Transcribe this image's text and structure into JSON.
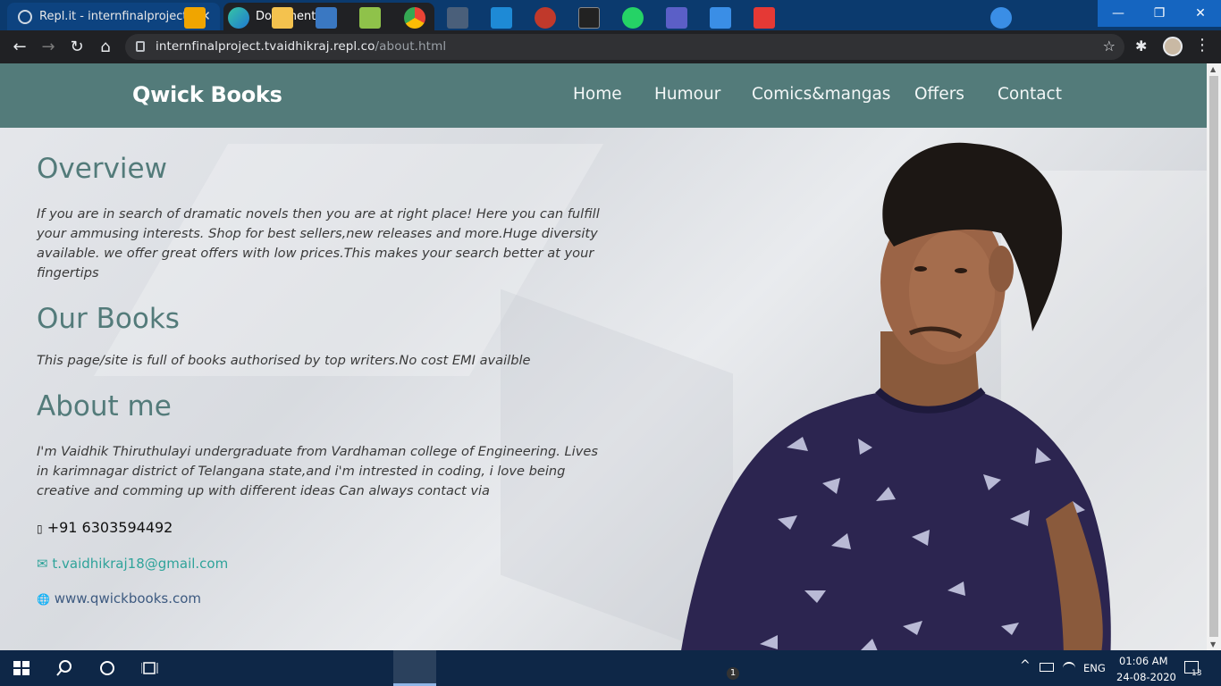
{
  "browser": {
    "tabs": [
      {
        "label": "Repl.it - internfinalproject",
        "close": "✕"
      },
      {
        "label": "Document",
        "close": "✕"
      }
    ],
    "new_tab": "+",
    "window_buttons": {
      "minimize": "—",
      "maximize": "❐",
      "close": "✕"
    },
    "url_host": "internfinalproject.tvaidhikraj.repl.co",
    "url_path": "/about.html",
    "nav_icons": {
      "back": "←",
      "forward": "→",
      "reload": "↻",
      "home": "⌂",
      "star": "☆",
      "extensions": "✱",
      "menu": "⋮"
    }
  },
  "site": {
    "brand": "Qwick Books",
    "nav": [
      "Home",
      "Humour",
      "Comics&mangas",
      "Offers",
      "Contact"
    ],
    "sections": {
      "overview_title": "Overview",
      "overview_text": "If you are in search of dramatic novels then you are at right place! Here you can fulfill your ammusing interests. Shop for best sellers,new releases and more.Huge diversity available. we offer great offers with low prices.This makes your search better at your fingertips",
      "books_title": "Our Books",
      "books_text": "This page/site is full of books authorised by top writers.No cost EMI availble",
      "about_title": "About me",
      "about_text": "I'm Vaidhik Thiruthulayi undergraduate from Vardhaman college of Engineering. Lives in karimnagar district of Telangana state,and i'm intrested in coding, i love being creative and comming up with different ideas Can always contact via"
    },
    "contact": {
      "phone_icon": "▯",
      "phone": "+91 6303594492",
      "email_icon": "✉",
      "email": "t.vaidhikraj18@gmail.com",
      "web_icon": "🌐",
      "website": "www.qwickbooks.com"
    }
  },
  "taskbar": {
    "time": "01:06 AM",
    "date": "24-08-2020",
    "lang": "ENG",
    "notification_count": "13",
    "mail_badge": "1",
    "up_arrow": "^"
  },
  "colors": {
    "nav_bg": "#537b7a",
    "heading": "#537b7a",
    "link": "#2fa39a",
    "taskbar": "#0e2747"
  }
}
